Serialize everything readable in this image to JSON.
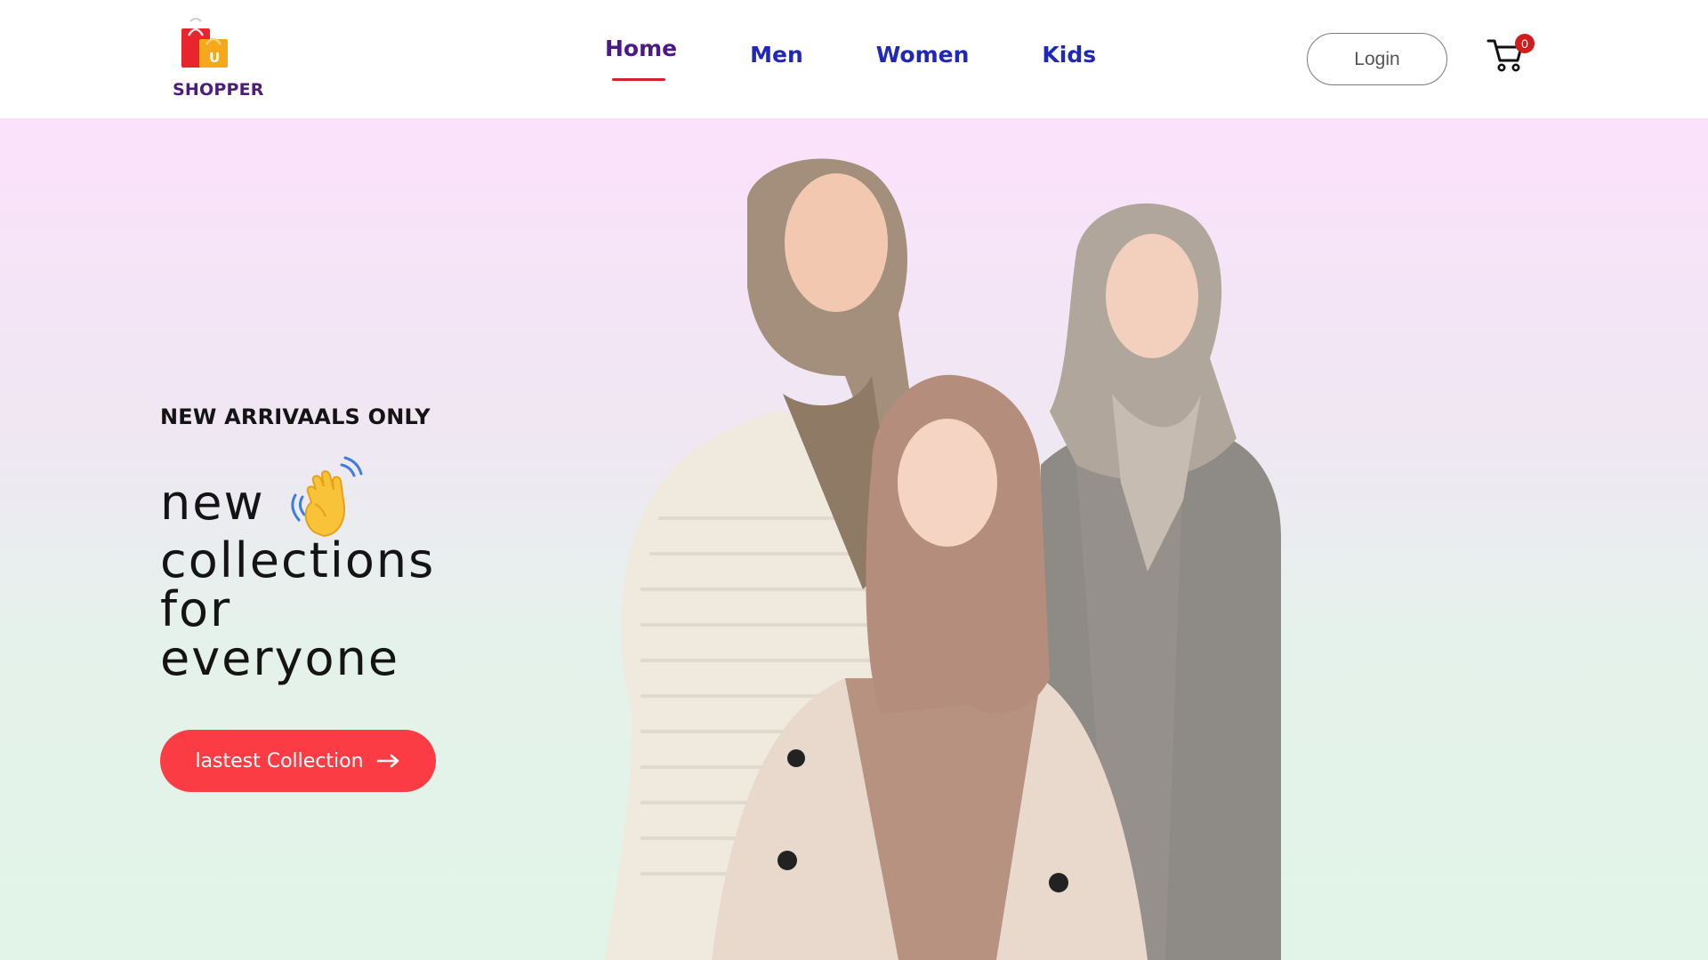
{
  "brand": {
    "name": "SHOPPER"
  },
  "nav": {
    "items": [
      {
        "label": "Home"
      },
      {
        "label": "Men"
      },
      {
        "label": "Women"
      },
      {
        "label": "Kids"
      }
    ],
    "active": "Home"
  },
  "header": {
    "login_label": "Login",
    "cart_count": "0"
  },
  "hero": {
    "tagline": "NEW ARRIVAALS ONLY",
    "line1": "new",
    "line2": "collections",
    "line3": "for",
    "line4": "everyone",
    "cta_label": "lastest Collection"
  },
  "icons": {
    "logo": "shopping-bags-icon",
    "hand": "waving-hand-icon",
    "cart": "cart-icon",
    "arrow": "arrow-right-icon"
  },
  "colors": {
    "accent": "#fb3c45",
    "nav_link": "#1f28b8",
    "nav_active": "#4b1a86",
    "underline": "#d6202e",
    "badge": "#d01c1c"
  }
}
